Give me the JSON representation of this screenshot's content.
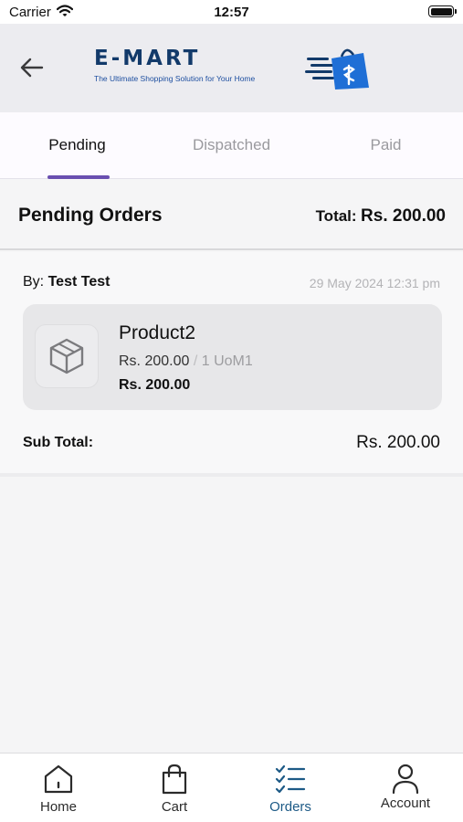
{
  "status_bar": {
    "carrier": "Carrier",
    "time": "12:57"
  },
  "header": {
    "brand_name": "E-MART",
    "tagline": "The Ultimate Shopping Solution for Your Home",
    "icons": {
      "back": "arrow-left-icon",
      "logo": "shopping-bag-logo"
    }
  },
  "tabs": [
    {
      "label": "Pending",
      "active": true
    },
    {
      "label": "Dispatched",
      "active": false
    },
    {
      "label": "Paid",
      "active": false
    }
  ],
  "section": {
    "title": "Pending Orders",
    "total_label": "Total:",
    "total_value": "Rs. 200.00"
  },
  "order": {
    "by_label": "By:",
    "customer": "Test Test",
    "date": "29 May 2024  12:31 pm",
    "items": [
      {
        "name": "Product2",
        "unit_price": "Rs. 200.00",
        "separator": "/",
        "quantity": "1 UoM1",
        "line_total": "Rs. 200.00",
        "icon": "box-icon"
      }
    ],
    "subtotal_label": "Sub Total:",
    "subtotal_value": "Rs. 200.00"
  },
  "bottom_nav": [
    {
      "label": "Home",
      "icon": "home-icon",
      "active": false
    },
    {
      "label": "Cart",
      "icon": "shopping-bag-icon",
      "active": false
    },
    {
      "label": "Orders",
      "icon": "checklist-icon",
      "active": true
    },
    {
      "label": "Account",
      "icon": "person-icon",
      "active": false
    }
  ],
  "colors": {
    "accent": "#6a4fb0",
    "active_nav": "#1d5a86",
    "brand": "#123a6a",
    "logo_blue": "#1f6fd6"
  }
}
